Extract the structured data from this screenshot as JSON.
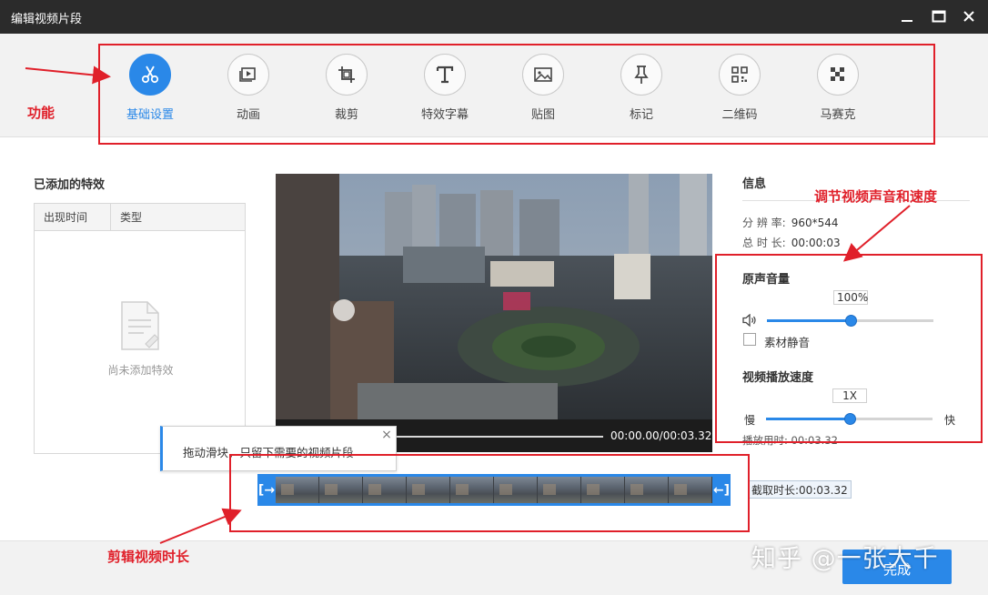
{
  "window": {
    "title": "编辑视频片段"
  },
  "toolbar": {
    "tools": [
      {
        "label": "基础设置",
        "icon": "scissors-icon",
        "active": true
      },
      {
        "label": "动画",
        "icon": "animation-icon"
      },
      {
        "label": "裁剪",
        "icon": "crop-icon"
      },
      {
        "label": "特效字幕",
        "icon": "text-icon"
      },
      {
        "label": "贴图",
        "icon": "image-icon"
      },
      {
        "label": "标记",
        "icon": "pin-icon"
      },
      {
        "label": "二维码",
        "icon": "qrcode-icon"
      },
      {
        "label": "马赛克",
        "icon": "mosaic-icon"
      }
    ]
  },
  "effects": {
    "title": "已添加的特效",
    "columns": [
      "出现时间",
      "类型"
    ],
    "empty_text": "尚未添加特效"
  },
  "player": {
    "time": "00:00.00/00:03.32"
  },
  "tooltip": {
    "text": "拖动滑块，只留下需要的视频片段",
    "close": "×"
  },
  "trim": {
    "left_handle": "[→",
    "right_handle": "←]",
    "clip_length": "截取时长:00:03.32",
    "frame_count": 10
  },
  "info": {
    "title": "信息",
    "resolution_label": "分 辨 率:",
    "resolution": "960*544",
    "duration_label": "总 时 长:",
    "duration": "00:00:03"
  },
  "audio": {
    "title": "原声音量",
    "volume": "100%",
    "volume_fraction": 0.5,
    "mute_label": "素材静音",
    "muted": false
  },
  "speed": {
    "title": "视频播放速度",
    "value": "1X",
    "fraction": 0.5,
    "slow": "慢",
    "fast": "快",
    "play_time": "播放用时: 00:03.32"
  },
  "buttons": {
    "done": "完成"
  },
  "annotations": {
    "function": "功能",
    "audio_speed": "调节视频声音和速度",
    "trim": "剪辑视频时长",
    "color": "#e0202a"
  },
  "watermark": "知乎 @一张大千"
}
